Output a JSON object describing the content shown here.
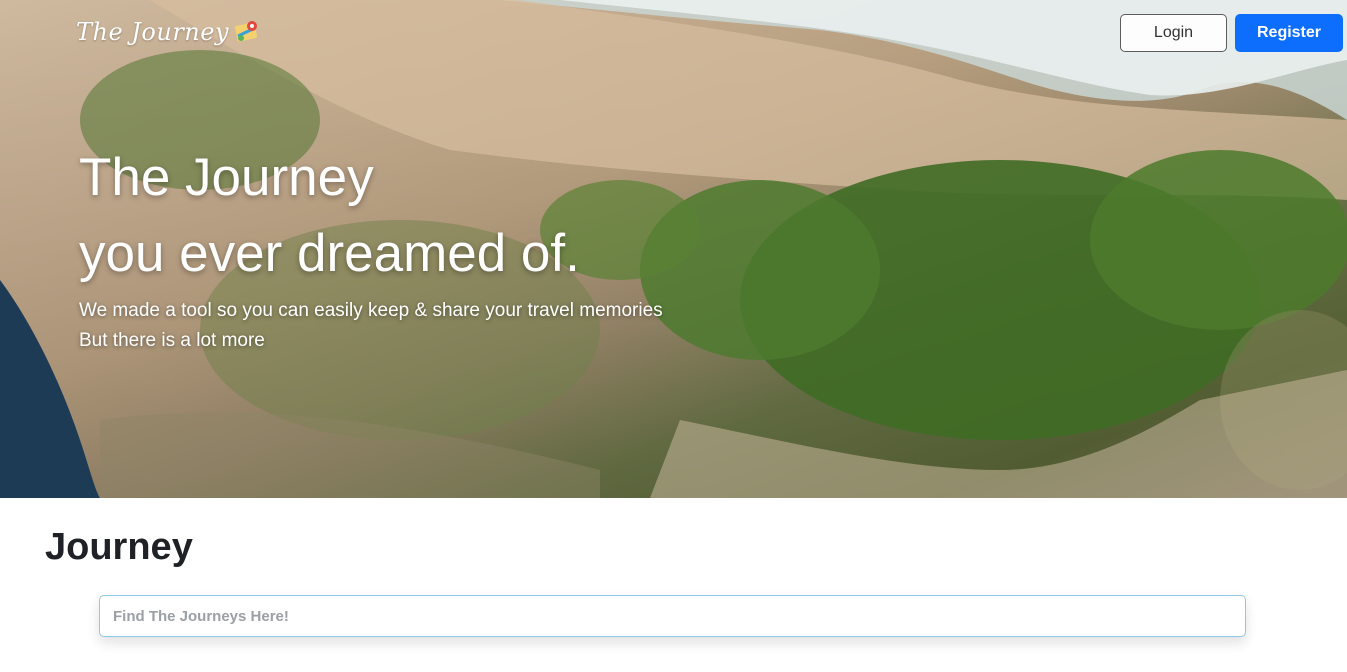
{
  "header": {
    "logo_text": "The Journey",
    "logo_icon": "map-pin-icon",
    "login_label": "Login",
    "register_label": "Register"
  },
  "hero": {
    "title_line1": "The Journey",
    "title_line2": "you ever dreamed of.",
    "subtitle_line1": "We made a tool so you can easily keep & share your travel memories",
    "subtitle_line2": "But there is a lot more",
    "background_image": "aerial-beach-cliff-photo"
  },
  "main": {
    "section_title": "Journey",
    "search": {
      "placeholder": "Find The Journeys Here!",
      "value": ""
    }
  },
  "colors": {
    "primary": "#0d6efd",
    "heading": "#1e2227",
    "search_border": "#8fc9e8"
  }
}
